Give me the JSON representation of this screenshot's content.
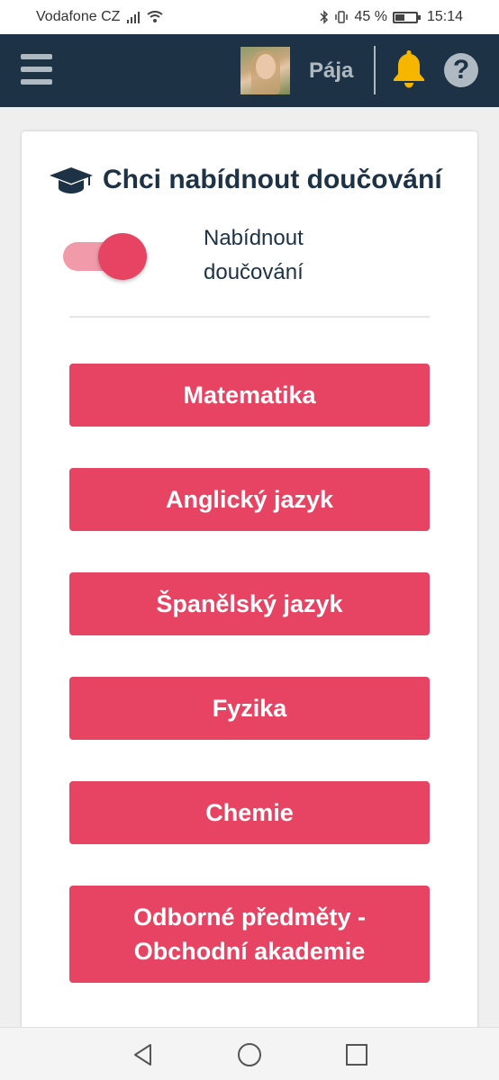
{
  "status_bar": {
    "carrier": "Vodafone CZ",
    "battery_text": "45 %",
    "battery_level": 0.45,
    "time": "15:14"
  },
  "header": {
    "user_name": "Pája",
    "help_glyph": "?",
    "icons": [
      "menu-icon",
      "avatar",
      "bell-icon",
      "help-icon"
    ],
    "bell_color": "#f6b600"
  },
  "card": {
    "title": "Chci nabídnout doučování",
    "toggle": {
      "label": "Nabídnout doučování",
      "on": true
    },
    "subjects": [
      "Matematika",
      "Anglický jazyk",
      "Španělský jazyk",
      "Fyzika",
      "Chemie",
      "Odborné předměty - Obchodní akademie"
    ]
  },
  "colors": {
    "header_bg": "#1d3245",
    "accent": "#e64462",
    "header_icons": "#aeb9c2"
  },
  "nav_bar": {
    "buttons": [
      "back-icon",
      "home-icon",
      "recents-icon"
    ]
  }
}
